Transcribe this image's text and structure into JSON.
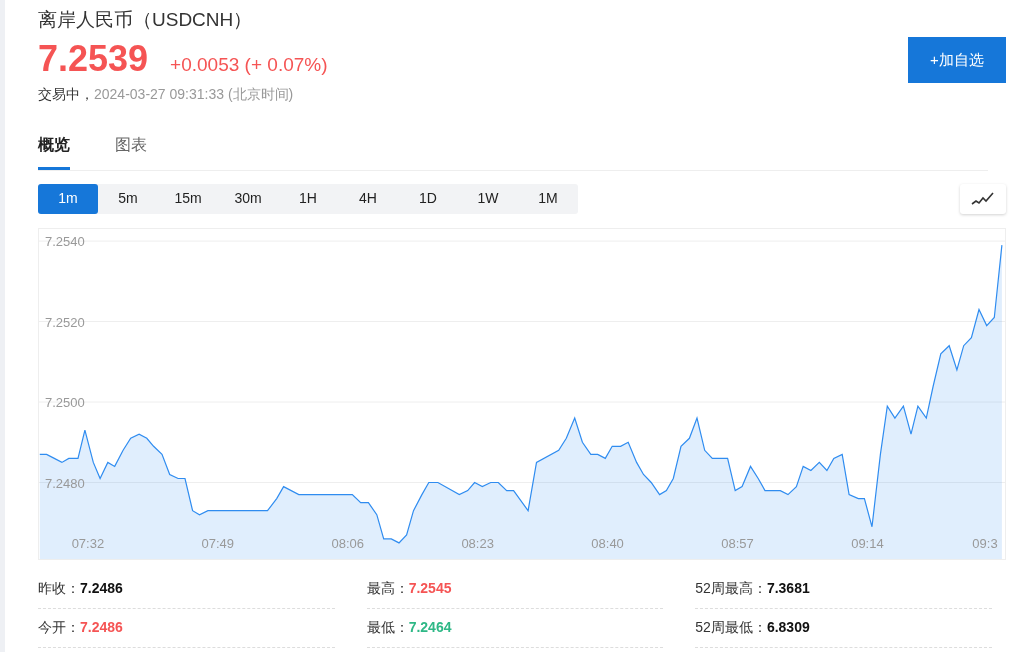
{
  "title": "离岸人民币（USDCNH）",
  "quote": {
    "price": "7.2539",
    "change": "+0.0053",
    "change_pct": "(+ 0.07%)",
    "status": "交易中，",
    "time": "2024-03-27 09:31:33 (北京时间)"
  },
  "watchlist_button": "+加自选",
  "tabs": [
    {
      "label": "概览",
      "selected": true
    },
    {
      "label": "图表",
      "selected": false
    }
  ],
  "intervals": [
    {
      "label": "1m",
      "selected": true
    },
    {
      "label": "5m",
      "selected": false
    },
    {
      "label": "15m",
      "selected": false
    },
    {
      "label": "30m",
      "selected": false
    },
    {
      "label": "1H",
      "selected": false
    },
    {
      "label": "4H",
      "selected": false
    },
    {
      "label": "1D",
      "selected": false
    },
    {
      "label": "1W",
      "selected": false
    },
    {
      "label": "1M",
      "selected": false
    }
  ],
  "chart_data": {
    "type": "area",
    "grid": true,
    "xlim": [
      445.6,
      572.0
    ],
    "ylim": [
      7.2461,
      7.2543
    ],
    "yticks": [
      {
        "value": 7.254,
        "label": "7.2540"
      },
      {
        "value": 7.252,
        "label": "7.2520"
      },
      {
        "value": 7.25,
        "label": "7.2500"
      },
      {
        "value": 7.248,
        "label": "7.2480"
      }
    ],
    "xticks": [
      {
        "value": 452,
        "label": "07:32"
      },
      {
        "value": 469,
        "label": "07:49"
      },
      {
        "value": 486,
        "label": "08:06"
      },
      {
        "value": 503,
        "label": "08:23"
      },
      {
        "value": 520,
        "label": "08:40"
      },
      {
        "value": 537,
        "label": "08:57"
      },
      {
        "value": 554,
        "label": "09:14"
      },
      {
        "value": 571,
        "label": "09:3"
      }
    ],
    "x": [
      445.7,
      446.6,
      447.6,
      448.6,
      449.5,
      450.7,
      451.6,
      452.7,
      453.6,
      454.6,
      455.5,
      456.6,
      457.6,
      458.7,
      459.7,
      460.6,
      461.7,
      462.7,
      463.8,
      464.7,
      465.7,
      466.6,
      467.7,
      475.5,
      476.7,
      477.6,
      479.6,
      486.6,
      487.7,
      488.7,
      489.8,
      490.7,
      491.7,
      492.7,
      493.7,
      494.6,
      495.7,
      496.6,
      497.8,
      500.6,
      501.7,
      502.6,
      503.6,
      504.7,
      505.7,
      506.8,
      507.7,
      509.6,
      510.7,
      513.6,
      514.6,
      515.7,
      516.7,
      517.8,
      518.7,
      519.7,
      520.6,
      521.7,
      522.7,
      523.8,
      524.7,
      525.7,
      526.8,
      527.7,
      528.6,
      529.6,
      530.7,
      531.7,
      532.7,
      533.7,
      535.7,
      536.7,
      537.6,
      538.7,
      539.7,
      540.6,
      541.7,
      542.6,
      543.6,
      544.7,
      545.6,
      546.6,
      547.7,
      548.7,
      549.6,
      550.7,
      551.6,
      552.8,
      553.6,
      554.6,
      555.7,
      556.6,
      557.6,
      558.7,
      559.7,
      560.6,
      561.7,
      562.6,
      563.6,
      564.7,
      565.7,
      566.6,
      567.6,
      568.6,
      569.6,
      570.6,
      571.6
    ],
    "series": [
      {
        "color": "#2f8cf0",
        "values": [
          7.2487,
          7.2487,
          7.2486,
          7.2485,
          7.2486,
          7.2486,
          7.2493,
          7.2485,
          7.2481,
          7.2485,
          7.2484,
          7.2488,
          7.2491,
          7.2492,
          7.2491,
          7.2489,
          7.2487,
          7.2482,
          7.2481,
          7.2481,
          7.2473,
          7.2472,
          7.2473,
          7.2473,
          7.2476,
          7.2479,
          7.2477,
          7.2477,
          7.2475,
          7.2475,
          7.2472,
          7.2466,
          7.2466,
          7.2465,
          7.2467,
          7.2473,
          7.2477,
          7.248,
          7.248,
          7.2477,
          7.2478,
          7.248,
          7.2479,
          7.248,
          7.248,
          7.2478,
          7.2478,
          7.2473,
          7.2485,
          7.2488,
          7.2491,
          7.2496,
          7.249,
          7.2487,
          7.2487,
          7.2486,
          7.2489,
          7.2489,
          7.249,
          7.2485,
          7.2482,
          7.248,
          7.2477,
          7.2478,
          7.2481,
          7.2489,
          7.2491,
          7.2496,
          7.2488,
          7.2486,
          7.2486,
          7.2478,
          7.2479,
          7.2484,
          7.2481,
          7.2478,
          7.2478,
          7.2478,
          7.2477,
          7.2479,
          7.2484,
          7.2483,
          7.2485,
          7.2483,
          7.2486,
          7.2487,
          7.2477,
          7.2476,
          7.2476,
          7.2469,
          7.2487,
          7.2499,
          7.2496,
          7.2499,
          7.2492,
          7.2499,
          7.2496,
          7.2504,
          7.2512,
          7.2514,
          7.2508,
          7.2514,
          7.2516,
          7.2523,
          7.2519,
          7.2521,
          7.2539
        ]
      }
    ]
  },
  "stats": [
    {
      "label": "昨收：",
      "value": "7.2486",
      "color": "#111111"
    },
    {
      "label": "最高：",
      "value": "7.2545",
      "color": "#f55454"
    },
    {
      "label": "52周最高：",
      "value": "7.3681",
      "color": "#111111"
    },
    {
      "label": "今开：",
      "value": "7.2486",
      "color": "#f55454"
    },
    {
      "label": "最低：",
      "value": "7.2464",
      "color": "#2eb886"
    },
    {
      "label": "52周最低：",
      "value": "6.8309",
      "color": "#111111"
    }
  ]
}
